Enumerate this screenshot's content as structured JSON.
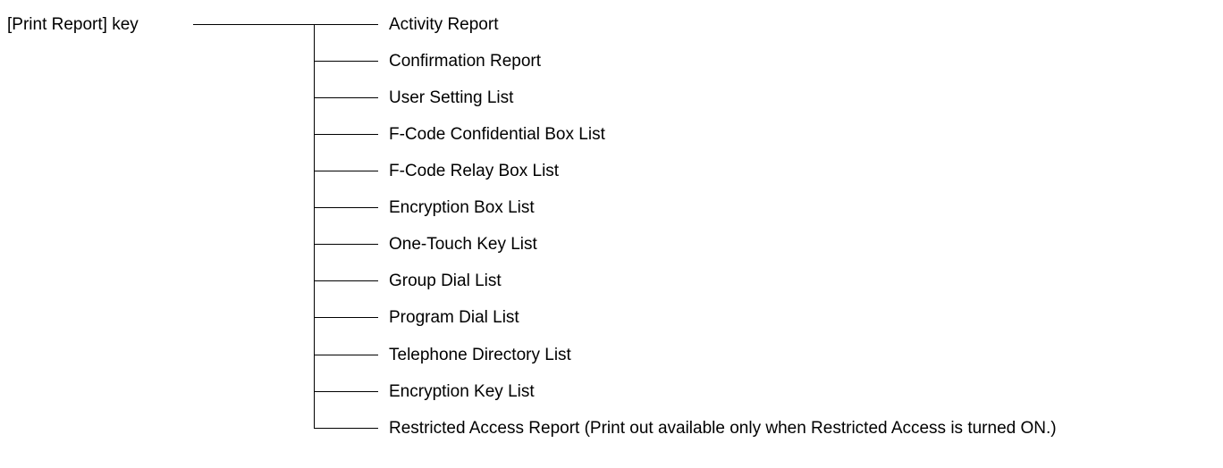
{
  "root": {
    "label": "[Print Report] key"
  },
  "items": [
    {
      "label": "Activity Report"
    },
    {
      "label": "Confirmation Report"
    },
    {
      "label": "User Setting List"
    },
    {
      "label": "F-Code Confidential Box List"
    },
    {
      "label": "F-Code Relay Box List"
    },
    {
      "label": "Encryption Box List"
    },
    {
      "label": "One-Touch Key List"
    },
    {
      "label": "Group Dial List"
    },
    {
      "label": "Program Dial List"
    },
    {
      "label": "Telephone Directory List"
    },
    {
      "label": "Encryption Key List"
    },
    {
      "label": "Restricted Access Report (Print out available only when Restricted Access is turned ON.)"
    }
  ]
}
